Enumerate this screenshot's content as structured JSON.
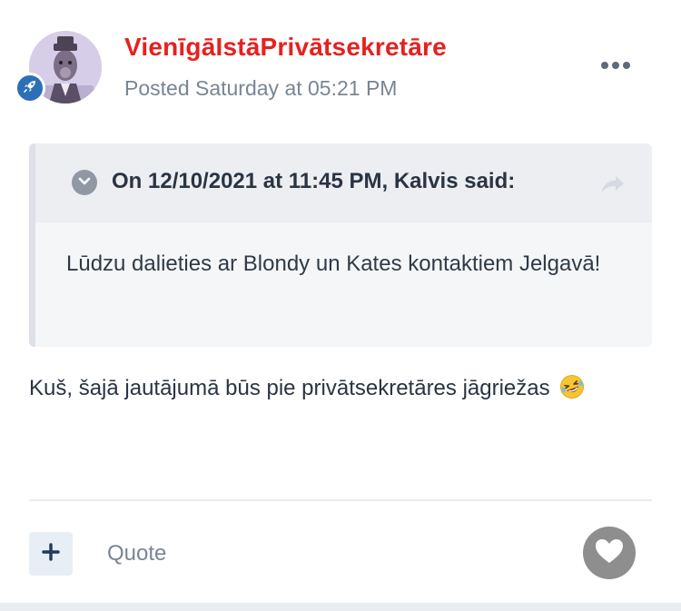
{
  "post": {
    "author": "VienīgāIstāPrivātsekretāre",
    "posted": "Posted Saturday at 05:21 PM",
    "quote": {
      "citation": "On 12/10/2021 at 11:45 PM, Kalvis said:",
      "body": "Lūdzu dalieties ar Blondy un Kates kontaktiem Jelgavā!"
    },
    "body": "Kuš, šajā jautājumā būs pie privātsekretāres jāgriežas",
    "body_emoji": "rolling-on-the-floor-laughing"
  },
  "actions": {
    "quote_label": "Quote"
  },
  "icons": {
    "rank_badge": "rocket-icon",
    "more": "ellipsis-icon",
    "toggle": "chevron-down-icon",
    "share": "share-arrow-icon",
    "add": "plus-icon",
    "like": "heart-icon"
  },
  "colors": {
    "author": "#e5211f",
    "badge": "#2d6fb6",
    "like_button": "#8e8e8e"
  }
}
